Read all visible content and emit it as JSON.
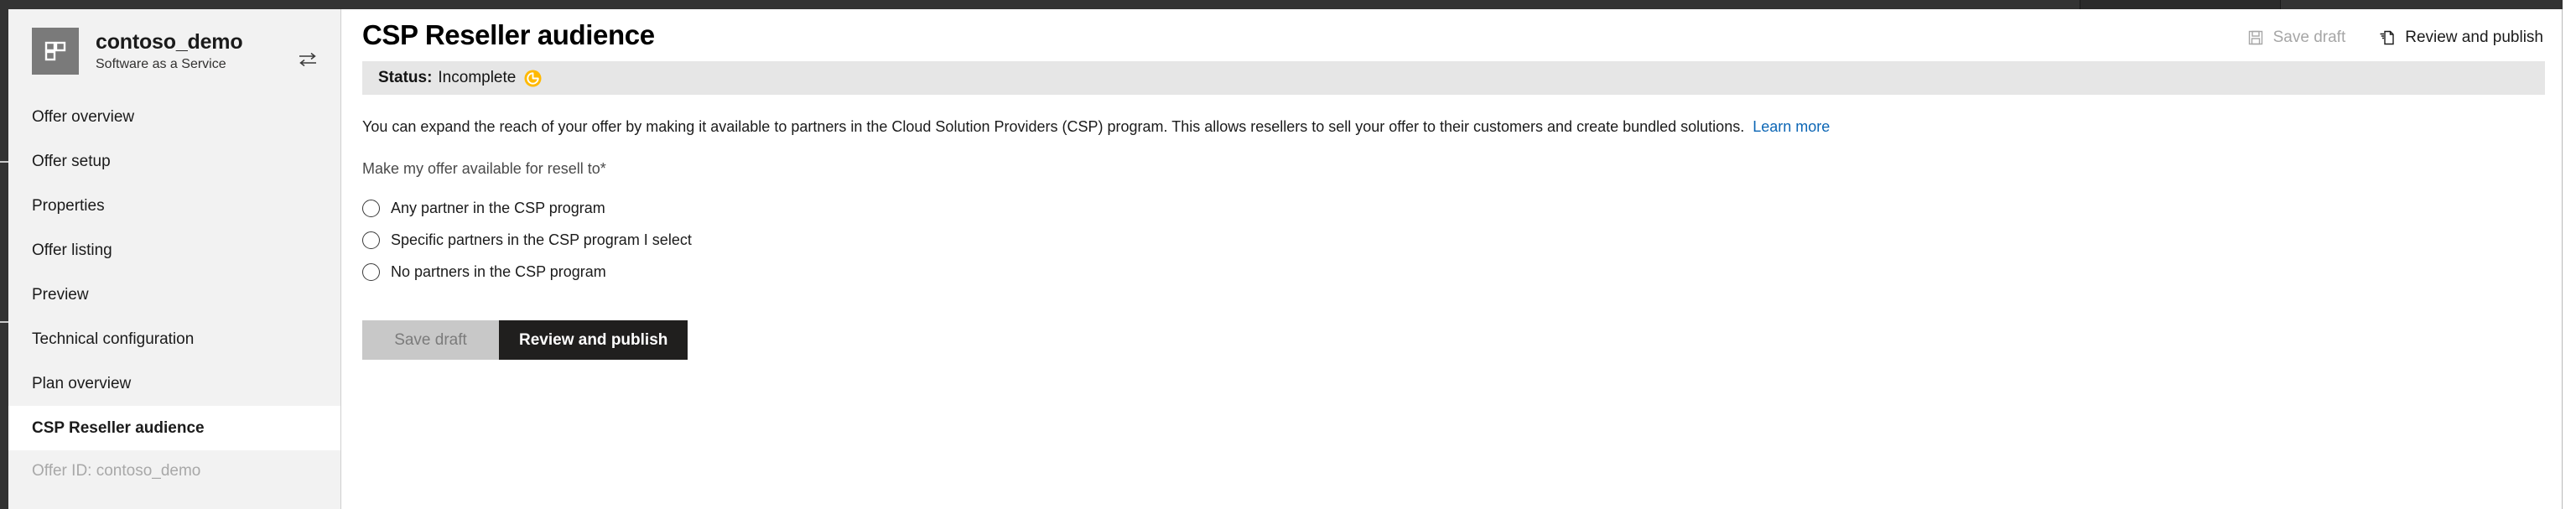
{
  "window": {
    "top_bar_color": "#333333"
  },
  "sidebar": {
    "offer": {
      "icon": "app-tiles-icon",
      "name": "contoso_demo",
      "subtitle": "Software as a Service",
      "switch_icon": "switch-offer-icon"
    },
    "items": [
      {
        "label": "Offer overview",
        "selected": false
      },
      {
        "label": "Offer setup",
        "selected": false
      },
      {
        "label": "Properties",
        "selected": false
      },
      {
        "label": "Offer listing",
        "selected": false
      },
      {
        "label": "Preview",
        "selected": false
      },
      {
        "label": "Technical configuration",
        "selected": false
      },
      {
        "label": "Plan overview",
        "selected": false
      },
      {
        "label": "CSP Reseller audience",
        "selected": true
      }
    ],
    "offer_id": "Offer ID: contoso_demo"
  },
  "header": {
    "title": "CSP Reseller audience",
    "actions": [
      {
        "label": "Save draft",
        "icon": "save-floppy-icon",
        "enabled": false
      },
      {
        "label": "Review and publish",
        "icon": "publish-document-icon",
        "enabled": true
      }
    ]
  },
  "status": {
    "label": "Status:",
    "value": "Incomplete",
    "icon": "incomplete-clock-icon",
    "icon_color": "#ffb900",
    "strip_color": "#e6e6e6"
  },
  "main": {
    "description": "You can expand the reach of your offer by making it available to partners in the Cloud Solution Providers (CSP) program. This allows resellers to sell your offer to their customers and create bundled solutions.",
    "learn_more": "Learn more",
    "learn_more_color": "#0c66b5",
    "field_label": "Make my offer available for resell to",
    "required_marker": "*",
    "radio_options": [
      {
        "label": "Any partner in the CSP program",
        "checked": false
      },
      {
        "label": "Specific partners in the CSP program I select",
        "checked": false
      },
      {
        "label": "No partners in the CSP program",
        "checked": false
      }
    ]
  },
  "footer": {
    "save_draft_label": "Save draft",
    "review_publish_label": "Review and publish"
  }
}
